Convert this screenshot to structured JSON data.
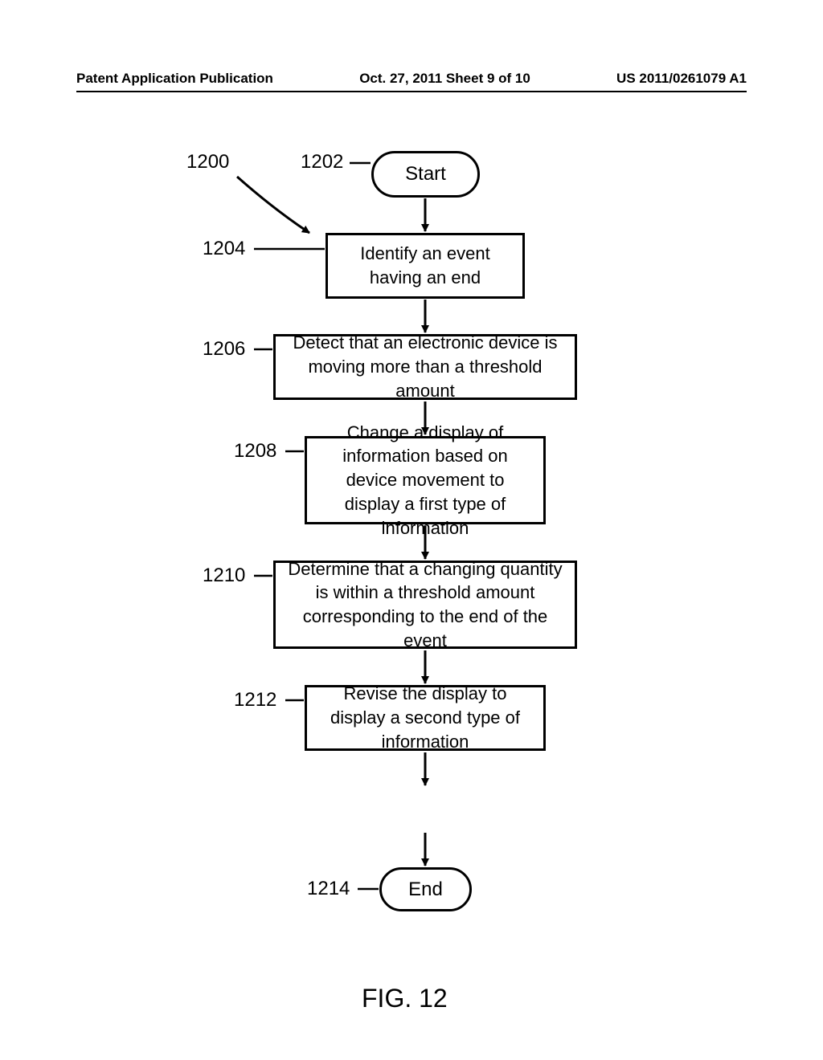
{
  "header": {
    "left": "Patent Application Publication",
    "center": "Oct. 27, 2011  Sheet 9 of 10",
    "right": "US 2011/0261079 A1"
  },
  "refs": {
    "r1200": "1200",
    "r1202": "1202",
    "r1204": "1204",
    "r1206": "1206",
    "r1208": "1208",
    "r1210": "1210",
    "r1212": "1212",
    "r1214": "1214"
  },
  "blocks": {
    "start": "Start",
    "step1204": "Identify an event having an end",
    "step1206": "Detect that an electronic device is moving more than a threshold amount",
    "step1208": "Change a display of information based on device movement to display a first type of information",
    "step1210": "Determine that a changing quantity is within a threshold amount corresponding to the end of the event",
    "step1212": "Revise the display to display a second type of information",
    "end": "End"
  },
  "figure_label": "FIG. 12"
}
